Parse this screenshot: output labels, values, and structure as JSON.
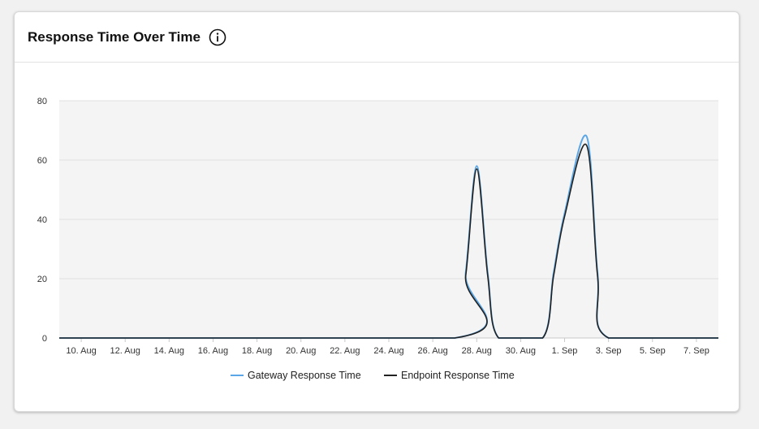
{
  "card": {
    "title": "Response Time Over Time"
  },
  "icons": {
    "info": "info-circle-icon"
  },
  "colors": {
    "gateway": "#5aa6e6",
    "endpoint": "#222222",
    "plot_background": "#f4f4f4",
    "grid": "#e1e1e1"
  },
  "chart_data": {
    "type": "line",
    "title": "Response Time Over Time",
    "xlabel": "",
    "ylabel": "",
    "ylim": [
      0,
      80
    ],
    "yticks": [
      0,
      20,
      40,
      60,
      80
    ],
    "xlim": [
      "2023-08-09",
      "2023-09-08"
    ],
    "xticks": [
      "10. Aug",
      "12. Aug",
      "14. Aug",
      "16. Aug",
      "18. Aug",
      "20. Aug",
      "22. Aug",
      "24. Aug",
      "26. Aug",
      "28. Aug",
      "30. Aug",
      "1. Sep",
      "3. Sep",
      "5. Sep",
      "7. Sep"
    ],
    "grid": true,
    "legend_position": "bottom",
    "series": [
      {
        "name": "Gateway Response Time",
        "color": "#5aa6e6",
        "points": [
          [
            "2023-08-09",
            0
          ],
          [
            "2023-08-27",
            0
          ],
          [
            "2023-08-27 12:00",
            22
          ],
          [
            "2023-08-28",
            58
          ],
          [
            "2023-08-28 12:00",
            22
          ],
          [
            "2023-08-29",
            0
          ],
          [
            "2023-08-31",
            0
          ],
          [
            "2023-08-31 12:00",
            22
          ],
          [
            "2023-09-01",
            42
          ],
          [
            "2023-09-02",
            68
          ],
          [
            "2023-09-02 12:00",
            22
          ],
          [
            "2023-09-03",
            0
          ],
          [
            "2023-09-08",
            0
          ]
        ]
      },
      {
        "name": "Endpoint Response Time",
        "color": "#222222",
        "points": [
          [
            "2023-08-09",
            0
          ],
          [
            "2023-08-27",
            0
          ],
          [
            "2023-08-27 12:00",
            21
          ],
          [
            "2023-08-28",
            57
          ],
          [
            "2023-08-28 12:00",
            21
          ],
          [
            "2023-08-29",
            0
          ],
          [
            "2023-08-31",
            0
          ],
          [
            "2023-08-31 12:00",
            21
          ],
          [
            "2023-09-01",
            41
          ],
          [
            "2023-09-02",
            65
          ],
          [
            "2023-09-02 12:00",
            21
          ],
          [
            "2023-09-03",
            0
          ],
          [
            "2023-09-08",
            0
          ]
        ]
      }
    ]
  }
}
